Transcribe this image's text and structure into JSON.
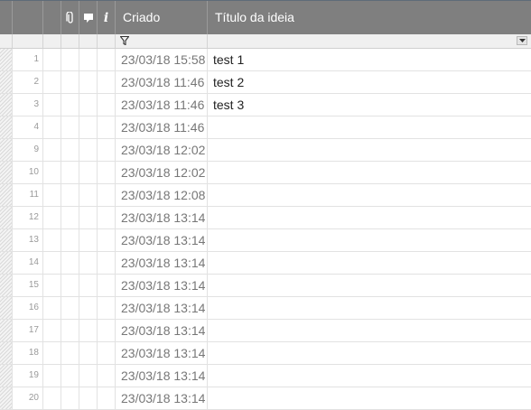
{
  "header": {
    "attachments_icon": "paperclip-icon",
    "comments_icon": "comment-icon",
    "info_icon": "info-icon",
    "info_glyph": "i",
    "col_created": "Criado",
    "col_title": "Título da ideia"
  },
  "filter": {
    "created_filter_icon": "filter-icon",
    "title_dropdown_icon": "dropdown-arrow-icon"
  },
  "rows": [
    {
      "num": "1",
      "created": "23/03/18 15:58",
      "title": "test 1"
    },
    {
      "num": "2",
      "created": "23/03/18 11:46",
      "title": "test 2"
    },
    {
      "num": "3",
      "created": "23/03/18 11:46",
      "title": "test 3"
    },
    {
      "num": "4",
      "created": "23/03/18 11:46",
      "title": ""
    },
    {
      "num": "9",
      "created": "23/03/18 12:02",
      "title": ""
    },
    {
      "num": "10",
      "created": "23/03/18 12:02",
      "title": ""
    },
    {
      "num": "11",
      "created": "23/03/18 12:08",
      "title": ""
    },
    {
      "num": "12",
      "created": "23/03/18 13:14",
      "title": ""
    },
    {
      "num": "13",
      "created": "23/03/18 13:14",
      "title": ""
    },
    {
      "num": "14",
      "created": "23/03/18 13:14",
      "title": ""
    },
    {
      "num": "15",
      "created": "23/03/18 13:14",
      "title": ""
    },
    {
      "num": "16",
      "created": "23/03/18 13:14",
      "title": ""
    },
    {
      "num": "17",
      "created": "23/03/18 13:14",
      "title": ""
    },
    {
      "num": "18",
      "created": "23/03/18 13:14",
      "title": ""
    },
    {
      "num": "19",
      "created": "23/03/18 13:14",
      "title": ""
    },
    {
      "num": "20",
      "created": "23/03/18 13:14",
      "title": ""
    }
  ],
  "colors": {
    "header_bg": "#7f7f7f",
    "header_text": "#ffffff",
    "grid_line": "#e2e2e2",
    "row_number": "#9a9a9a",
    "created_text": "#777777"
  }
}
